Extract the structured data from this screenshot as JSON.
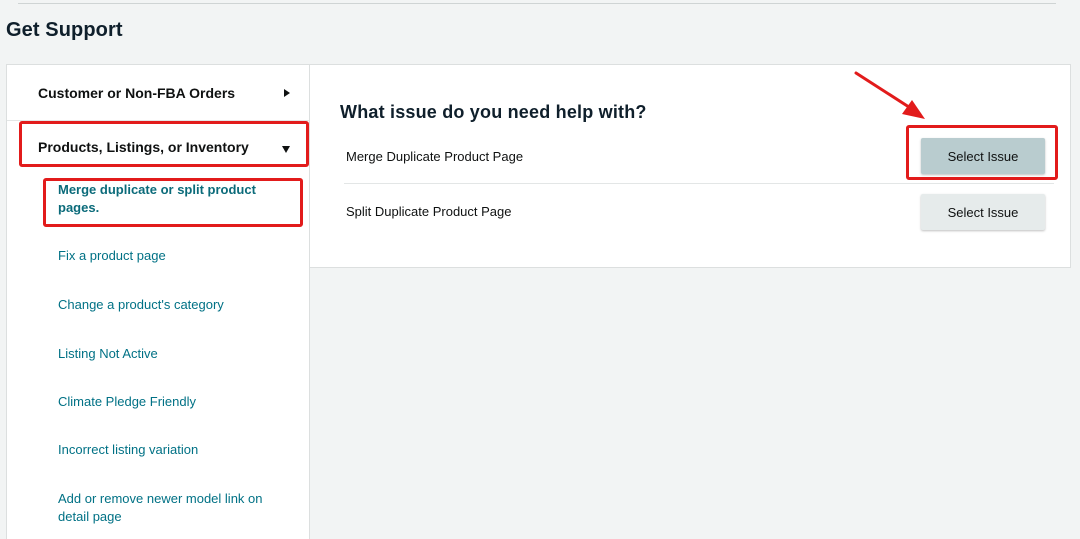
{
  "page": {
    "title": "Get Support"
  },
  "sidebar": {
    "categories": [
      {
        "label": "Customer or Non-FBA Orders",
        "arrow_icon": "triangle-right-icon"
      },
      {
        "label": "Products, Listings, or Inventory",
        "arrow_icon": "triangle-down-icon"
      }
    ],
    "subitems": [
      {
        "label": "Merge duplicate or split product pages.",
        "active": true
      },
      {
        "label": "Fix a product page"
      },
      {
        "label": "Change a product's category"
      },
      {
        "label": "Listing Not Active"
      },
      {
        "label": "Climate Pledge Friendly"
      },
      {
        "label": "Incorrect listing variation"
      },
      {
        "label": "Add or remove newer model link on detail page"
      }
    ]
  },
  "main": {
    "question": "What issue do you need help with?",
    "issues": [
      {
        "label": "Merge Duplicate Product Page",
        "button_label": "Select Issue"
      },
      {
        "label": "Split Duplicate Product Page",
        "button_label": "Select Issue"
      }
    ]
  },
  "colors": {
    "link": "#007185",
    "annotation_red": "#e21b1b",
    "button_highlight": "#b9cccf",
    "button_default": "#e6ebeb"
  }
}
